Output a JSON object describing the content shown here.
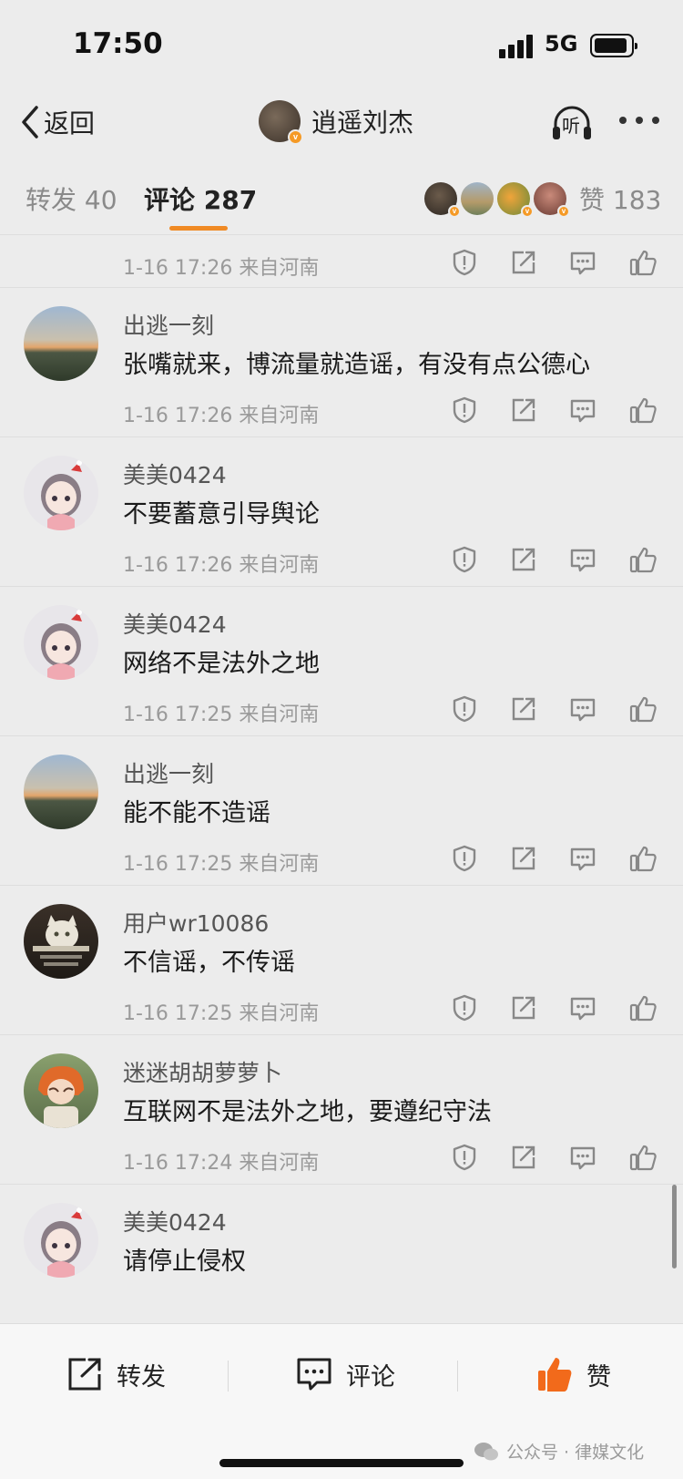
{
  "status": {
    "time": "17:50",
    "network": "5G"
  },
  "nav": {
    "back_label": "返回",
    "title": "逍遥刘杰",
    "listen_label": "听"
  },
  "tabs": {
    "repost": "转发 40",
    "comment": "评论 287",
    "like": "赞 183"
  },
  "first_row": {
    "time": "1-16 17:26 来自河南"
  },
  "comments": [
    {
      "user": "出逃一刻",
      "text": "张嘴就来，博流量就造谣，有没有点公德心",
      "time": "1-16 17:26 来自河南",
      "avatar": "sunset"
    },
    {
      "user": "美美0424",
      "text": "不要蓄意引导舆论",
      "time": "1-16 17:26 来自河南",
      "avatar": "girl"
    },
    {
      "user": "美美0424",
      "text": "网络不是法外之地",
      "time": "1-16 17:25 来自河南",
      "avatar": "girl"
    },
    {
      "user": "出逃一刻",
      "text": "能不能不造谣",
      "time": "1-16 17:25 来自河南",
      "avatar": "sunset"
    },
    {
      "user": "用户wr10086",
      "text": "不信谣，不传谣",
      "time": "1-16 17:25 来自河南",
      "avatar": "cat"
    },
    {
      "user": "迷迷胡胡萝萝卜",
      "text": "互联网不是法外之地，要遵纪守法",
      "time": "1-16 17:24 来自河南",
      "avatar": "anime"
    },
    {
      "user": "美美0424",
      "text": "请停止侵权",
      "time": "",
      "avatar": "girl"
    }
  ],
  "bottom": {
    "repost_label": "转发",
    "comment_label": "评论",
    "like_label": "赞",
    "watermark": "公众号 · 律媒文化"
  },
  "colors": {
    "accent": "#f08a24",
    "badge": "#f59a26",
    "like_icon": "#f26a1b"
  }
}
